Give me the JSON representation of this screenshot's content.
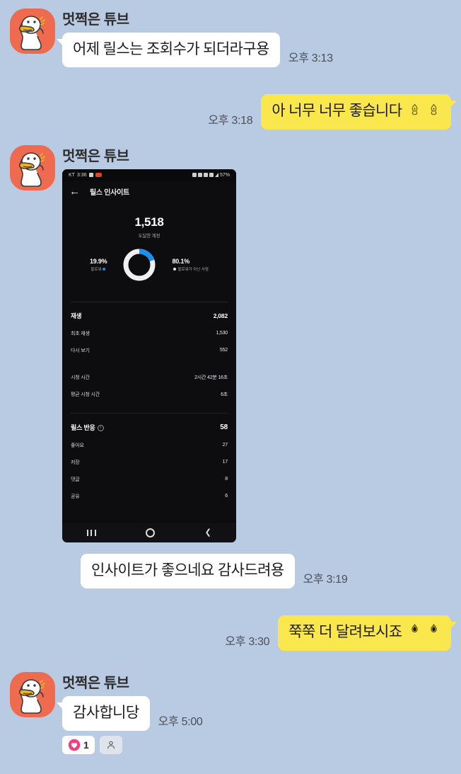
{
  "theme": {
    "background": "#b9cae3",
    "bubble_incoming": "#ffffff",
    "bubble_outgoing": "#fae64d",
    "avatar_background": "#ee6b4f",
    "accent_blue": "#1b8ef2",
    "reaction_pink": "#f0407e"
  },
  "messages": [
    {
      "sender": "멋쩍은 튜브",
      "text": "어제 릴스는 조회수가 되더라구용",
      "time": "오후 3:13"
    },
    {
      "text": "아 너무 너무 좋습니다",
      "time": "오후 3:18",
      "emoji_count": 2
    },
    {
      "sender": "멋쩍은 튜브",
      "time": ""
    },
    {
      "text": "인사이트가 좋으네요 감사드려용",
      "time": "오후 3:19"
    },
    {
      "text": "쭉쭉 더 달려보시죠",
      "time": "오후 3:30",
      "emoji_count": 2
    },
    {
      "sender": "멋쩍은 튜브",
      "text": "감사합니당",
      "time": "오후 5:00"
    }
  ],
  "sender_name": "멋쩍은 튜브",
  "msg1": {
    "text": "어제 릴스는 조회수가 되더라구용",
    "time": "오후 3:13"
  },
  "msg2": {
    "text": "아 너무 너무 좋습니다",
    "time": "오후 3:18"
  },
  "msg3": {
    "text": "인사이트가 좋으네요 감사드려용",
    "time": "오후 3:19"
  },
  "msg4": {
    "text": "쭉쭉 더 달려보시죠",
    "time": "오후 3:30"
  },
  "msg5": {
    "text": "감사합니당",
    "time": "오후 5:00"
  },
  "reactions": {
    "heart_count": "1",
    "person_label": ""
  },
  "screenshot": {
    "statusbar": {
      "carrier": "KT",
      "clock": "3:36",
      "battery": "57%"
    },
    "appbar": {
      "title": "릴스 인사이트",
      "back_icon": "arrow-left-icon"
    },
    "hero": {
      "value": "1,518",
      "label": "도달한 계정"
    },
    "donut": {
      "left_pct": "19.9%",
      "left_label": "팔로워",
      "right_pct": "80.1%",
      "right_label": "팔로워가 아닌 사람"
    },
    "plays_section": [
      {
        "label": "재생",
        "value": "2,082"
      },
      {
        "label": "최초 재생",
        "value": "1,530"
      },
      {
        "label": "다시 보기",
        "value": "552"
      }
    ],
    "time_section": [
      {
        "label": "시청 시간",
        "value": "2시간 42분 16초"
      },
      {
        "label": "평균 시청 시간",
        "value": "6초"
      }
    ],
    "reactions_section": {
      "header_label": "릴스 반응",
      "header_value": "58",
      "rows": [
        {
          "label": "좋아요",
          "value": "27"
        },
        {
          "label": "저장",
          "value": "17"
        },
        {
          "label": "댓글",
          "value": "8"
        },
        {
          "label": "공유",
          "value": "6"
        }
      ]
    },
    "navbar": {
      "recents": "recents-icon",
      "home": "home-icon",
      "back": "back-icon"
    }
  }
}
